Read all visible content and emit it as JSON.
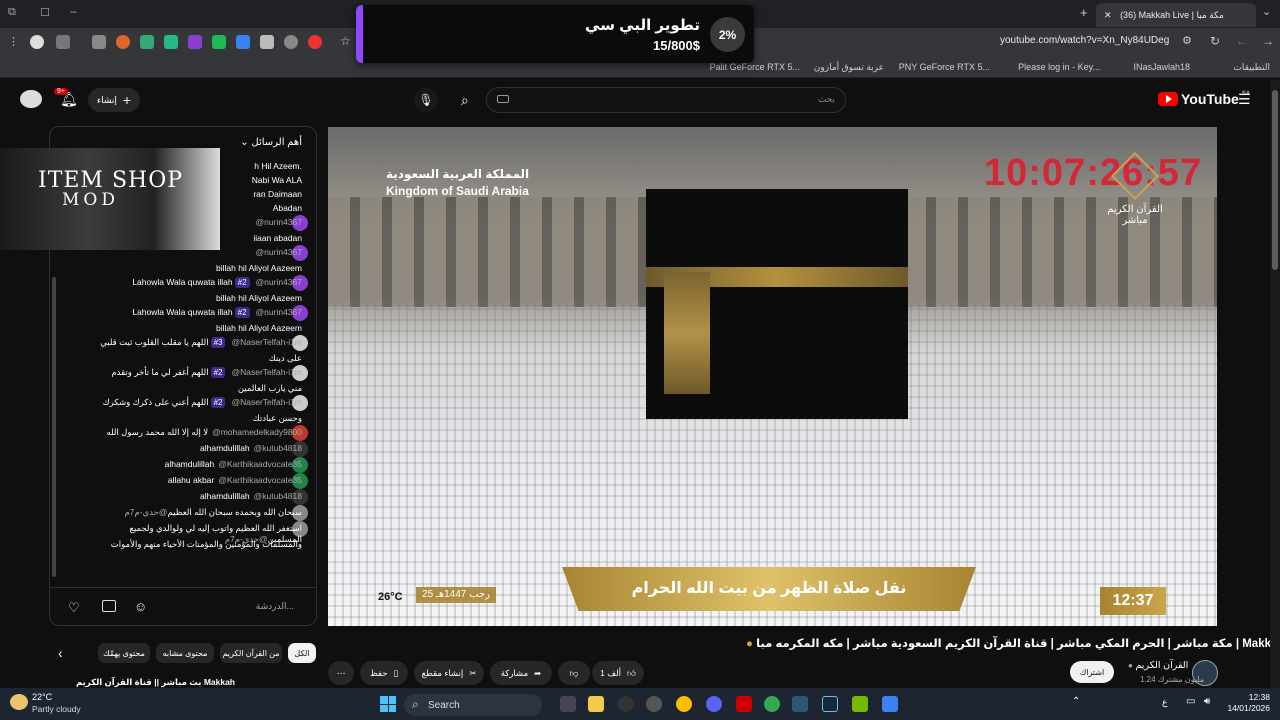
{
  "browser": {
    "tab_title": "(36) Makkah Live | مكة مبا",
    "url": "youtube.com/watch?v=Xn_Ny84UDeg",
    "bookmarks": [
      "التطبيقات",
      "INasJawlah18",
      "Please log in - Key...",
      "PNY GeForce RTX 5...",
      "عربة تسوق أمازون",
      "Palit GeForce RTX 5..."
    ]
  },
  "popup": {
    "title": "تطوير البي سي",
    "progress": "15/800$",
    "percent": "2%"
  },
  "youtube": {
    "logo": "YouTube",
    "logo_region": "SA",
    "search_placeholder": "بحث",
    "create_label": "إنشاء",
    "notif_count": "9+"
  },
  "chat": {
    "header": "أهم الرسائل",
    "overlay_line1": "ITEM SHOP",
    "overlay_line2": "MOD",
    "input_placeholder": "الدردشة...",
    "messages": [
      {
        "user": "",
        "text": "h Hil Azeem.",
        "badge": ""
      },
      {
        "user": "",
        "text": "Nabi Wa ALA",
        "badge": ""
      },
      {
        "user": "",
        "text": "ran Daimaan",
        "badge": ""
      },
      {
        "user": "",
        "text": "Abadan",
        "badge": ""
      },
      {
        "user": "@nurin4367",
        "text": "",
        "badge": ""
      },
      {
        "user": "",
        "text": "iiaan abadan",
        "badge": ""
      },
      {
        "user": "@nurin4367",
        "text": "",
        "badge": ""
      },
      {
        "user": "",
        "text": "billah hil Aliyol Aazeem",
        "badge": ""
      },
      {
        "user": "@nurin4367",
        "text": "Lahowla Wala quwata illah",
        "badge": "#2"
      },
      {
        "user": "",
        "text": "billah hil Aliyol Aazeem",
        "badge": ""
      },
      {
        "user": "@nurin4367",
        "text": "Lahowla Wala quwata illah",
        "badge": "#2"
      },
      {
        "user": "",
        "text": "billah hil Aliyol Aazeem",
        "badge": ""
      },
      {
        "user": "@NaserTelfah-i1m",
        "text": "اللهم يا مقلب القلوب ثبت قلبي",
        "badge": "#3"
      },
      {
        "user": "",
        "text": "على دينك",
        "badge": ""
      },
      {
        "user": "@NaserTelfah-i1m",
        "text": "اللهم أغفر لي ما تأخر وتقدم",
        "badge": "#2"
      },
      {
        "user": "",
        "text": "مني يارب العالمين",
        "badge": ""
      },
      {
        "user": "@NaserTelfah-i1m",
        "text": "اللهم أعني على ذكرك وشكرك",
        "badge": "#2"
      },
      {
        "user": "",
        "text": "وحسن عبادتك",
        "badge": ""
      },
      {
        "user": "@mohamedelkady9800",
        "text": "لا إله إلا الله محمد رسول الله",
        "badge": ""
      },
      {
        "user": "@kutub4818",
        "text": "alhamdulillah",
        "badge": ""
      },
      {
        "user": "@Karthikaadvocate35",
        "text": "alhamdulillah",
        "badge": ""
      },
      {
        "user": "@Karthikaadvocate35",
        "text": "allahu akbar",
        "badge": ""
      },
      {
        "user": "@kutub4818",
        "text": "alhamdulillah",
        "badge": ""
      },
      {
        "user": "@حدي-م7م",
        "text": "سبحان الله وبحمده سبحان الله العظيم",
        "badge": ""
      },
      {
        "user": "@حدي-م7م",
        "text": "استغفر الله العظيم واتوب إليه لي ولوالدي ولجميع المسلمين",
        "badge": ""
      },
      {
        "user": "",
        "text": "والمسلمات والمؤمنين والمؤمنات الأحياء منهم والأموات",
        "badge": ""
      }
    ]
  },
  "video": {
    "ksa_ar": "المملكة العربية السعودية",
    "ksa_en": "Kingdom of Saudi Arabia",
    "clock": "10:07:26:57",
    "channel_logo_line1": "القرآن الكريم",
    "channel_logo_line2": "مباشر",
    "banner": "نقل صلاة الظهر من بيت الله الحرام",
    "time": "12:37",
    "date": "25 رجب 1447هـ",
    "temperature": "26°C",
    "title": "مكة مباشر | الحرم المكي مباشر | قناة القرآن الكريم السعودية مباشر | مكه المكرمه مبا | Makkah Live"
  },
  "actions": {
    "like": "1 ألف",
    "share": "مشاركة",
    "clip": "إنشاء مقطع",
    "save": "حفظ"
  },
  "channel": {
    "name": "القرآن الكريم",
    "subs": "1.24 مليون مشترك",
    "subscribe": "اشتراك"
  },
  "chips": [
    "الكل",
    "من القرآن الكريم",
    "محتوى مشابه",
    "محتوى يهمّك"
  ],
  "next_video": "بث مباشر || قناة القرآن الكريم Makkah",
  "taskbar": {
    "temp": "22°C",
    "weather": "Partly cloudy",
    "search": "Search",
    "lang": "ع",
    "time": "12:38",
    "date": "14/01/2026"
  },
  "colors": {
    "accent_purple": "#9147ff",
    "yt_red": "#ff0000",
    "gold": "#c9a64a",
    "clock_red": "#e0192d"
  }
}
